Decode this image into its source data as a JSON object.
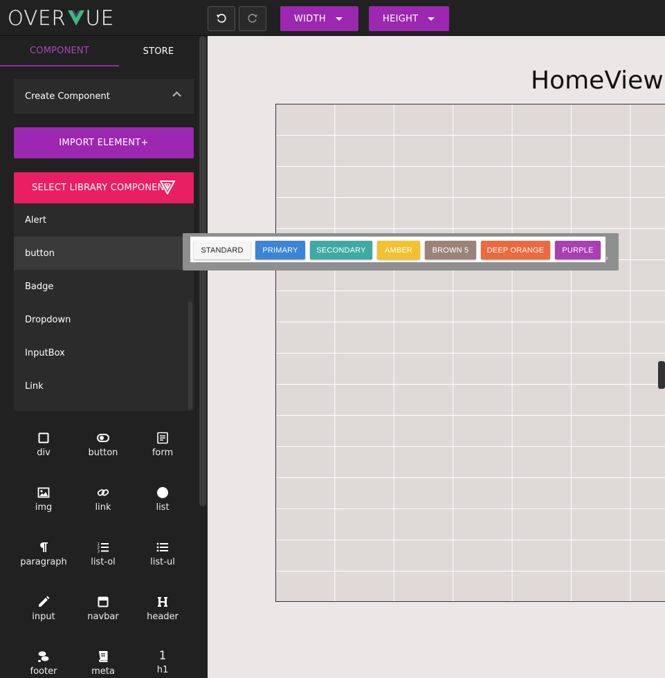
{
  "app": {
    "logo_left": "OVER",
    "logo_right": "UE",
    "logo_v_colors": [
      "#41b883",
      "#35495e"
    ]
  },
  "toolbar": {
    "undo_icon": "undo-icon",
    "redo_icon": "redo-icon",
    "width_label": "WIDTH",
    "height_label": "HEIGHT",
    "accent": "#9c27b0"
  },
  "sidebar": {
    "tabs": [
      {
        "label": "COMPONENT",
        "active": true
      },
      {
        "label": "STORE",
        "active": false
      }
    ],
    "create_panel": {
      "label": "Create Component",
      "expanded": true
    },
    "import_button": "IMPORT ELEMENT+",
    "library_button": "SELECT LIBRARY COMPONENT",
    "library_color": "#e91e63",
    "library_items": [
      {
        "label": "Alert",
        "highlighted": false
      },
      {
        "label": "button",
        "highlighted": true
      },
      {
        "label": "Badge",
        "highlighted": false
      },
      {
        "label": "Dropdown",
        "highlighted": false
      },
      {
        "label": "InputBox",
        "highlighted": false
      },
      {
        "label": "Link",
        "highlighted": false
      }
    ],
    "elements": [
      {
        "label": "div",
        "icon": "square-icon"
      },
      {
        "label": "button",
        "icon": "toggle-icon"
      },
      {
        "label": "form",
        "icon": "form-icon"
      },
      {
        "label": "img",
        "icon": "image-icon"
      },
      {
        "label": "link",
        "icon": "link-icon"
      },
      {
        "label": "list",
        "icon": "circle-icon"
      },
      {
        "label": "paragraph",
        "icon": "paragraph-icon"
      },
      {
        "label": "list-ol",
        "icon": "ordered-list-icon"
      },
      {
        "label": "list-ul",
        "icon": "unordered-list-icon"
      },
      {
        "label": "input",
        "icon": "pencil-icon"
      },
      {
        "label": "navbar",
        "icon": "navbar-icon"
      },
      {
        "label": "header",
        "icon": "heading-icon"
      },
      {
        "label": "footer",
        "icon": "footprint-icon"
      },
      {
        "label": "meta",
        "icon": "book-icon"
      },
      {
        "label": "h1",
        "icon": "numeral-one-icon",
        "glyph": "1"
      }
    ]
  },
  "canvas": {
    "view_title": "HomeView"
  },
  "button_group": {
    "buttons": [
      {
        "label": "STANDARD",
        "color": "#f5f5f5",
        "text_color": "#222222"
      },
      {
        "label": "PRIMARY",
        "color": "#3b84d6",
        "text_color": "#ffffff"
      },
      {
        "label": "SECONDARY",
        "color": "#3eaaa2",
        "text_color": "#ffffff"
      },
      {
        "label": "AMBER",
        "color": "#f3c12d",
        "text_color": "#ffffff"
      },
      {
        "label": "BROWN 5",
        "color": "#9c8377",
        "text_color": "#ffffff"
      },
      {
        "label": "DEEP ORANGE",
        "color": "#ec6a3e",
        "text_color": "#ffffff"
      },
      {
        "label": "PURPLE",
        "color": "#a83fb3",
        "text_color": "#ffffff"
      }
    ],
    "more_glyph": "›"
  }
}
